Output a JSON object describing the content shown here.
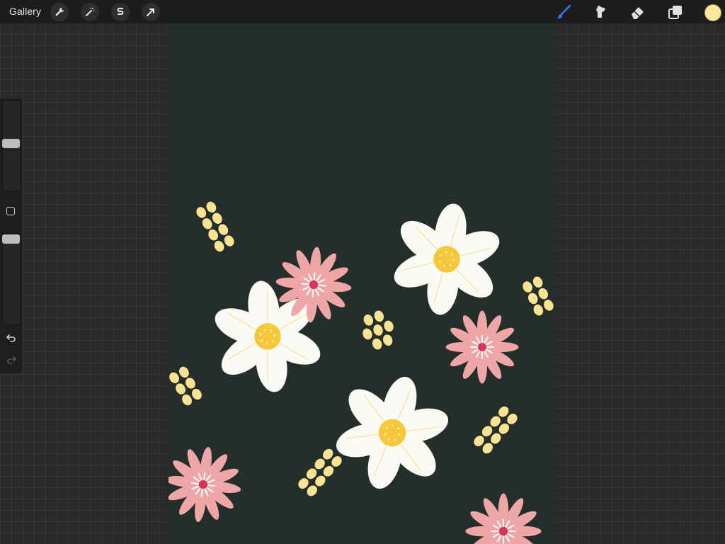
{
  "topbar": {
    "gallery_label": "Gallery",
    "left_tools": [
      {
        "name": "wrench-icon",
        "tool": "actions"
      },
      {
        "name": "magic-wand-icon",
        "tool": "adjustments"
      },
      {
        "name": "selection-s-icon",
        "tool": "selection"
      },
      {
        "name": "arrow-cursor-icon",
        "tool": "transform"
      }
    ],
    "right_tools": [
      {
        "name": "brush-icon",
        "tool": "paint",
        "active": true,
        "color": "#2f7bf6"
      },
      {
        "name": "smudge-icon",
        "tool": "smudge"
      },
      {
        "name": "eraser-icon",
        "tool": "erase"
      },
      {
        "name": "layers-icon",
        "tool": "layers"
      }
    ],
    "current_color": "#fbe79a"
  },
  "sidebar": {
    "brush_size_level": 0.52,
    "opacity_level": 0.98,
    "modify_icon": "square-modify-icon",
    "undo_icon": "undo-arrow-icon",
    "redo_icon": "redo-arrow-icon"
  },
  "canvas": {
    "background_color": "#242e2a",
    "colors": {
      "white_petal": "#fbfaf5",
      "pink_petal": "#efa6a6",
      "yellow_center": "#f6c73a",
      "pale_yellow_dots": "#f9e393",
      "red_center": "#d8335c"
    }
  }
}
